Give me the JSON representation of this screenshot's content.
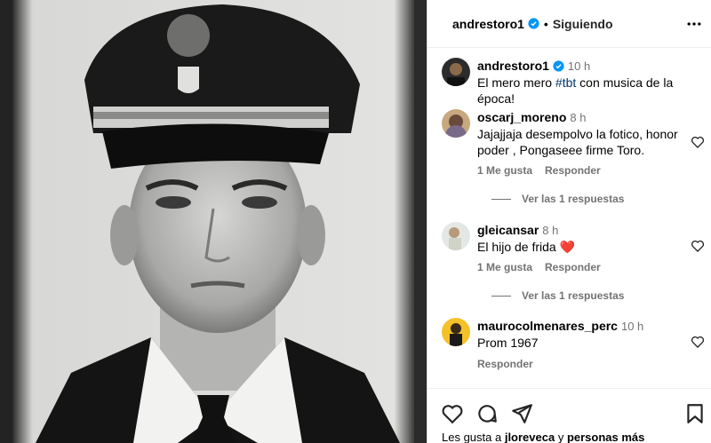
{
  "post": {
    "author": "andrestoro1",
    "follow_status": "Siguiendo",
    "separator": "•",
    "caption": {
      "time": "10 h",
      "text_before": "El mero mero ",
      "hashtag": "#tbt",
      "text_after": " con musica de la época!"
    }
  },
  "comments": [
    {
      "user": "oscarj_moreno",
      "time": "8 h",
      "text": "Jajajjaja desempolvo la fotico, honor poder , Pongaseee firme Toro.",
      "likes_label": "1 Me gusta",
      "reply_label": "Responder",
      "replies_label": "Ver las 1 respuestas"
    },
    {
      "user": "gleicansar",
      "time": "8 h",
      "text": "El hijo de frida ❤️",
      "likes_label": "1 Me gusta",
      "reply_label": "Responder",
      "replies_label": "Ver las 1 respuestas"
    },
    {
      "user": "maurocolmenares_perc",
      "time": "10 h",
      "text": "Prom 1967",
      "reply_label": "Responder"
    }
  ],
  "footer": {
    "likes_prefix": "Les gusta a ",
    "likes_user": "jloreveca",
    "likes_conj": " y ",
    "likes_others": "personas más"
  },
  "colors": {
    "verified_blue": "#0095f6",
    "hashtag": "#00376b",
    "muted": "#737373"
  },
  "icons": [
    "verified-badge-icon",
    "more-options-icon",
    "heart-icon",
    "comment-icon",
    "share-icon",
    "bookmark-icon"
  ]
}
